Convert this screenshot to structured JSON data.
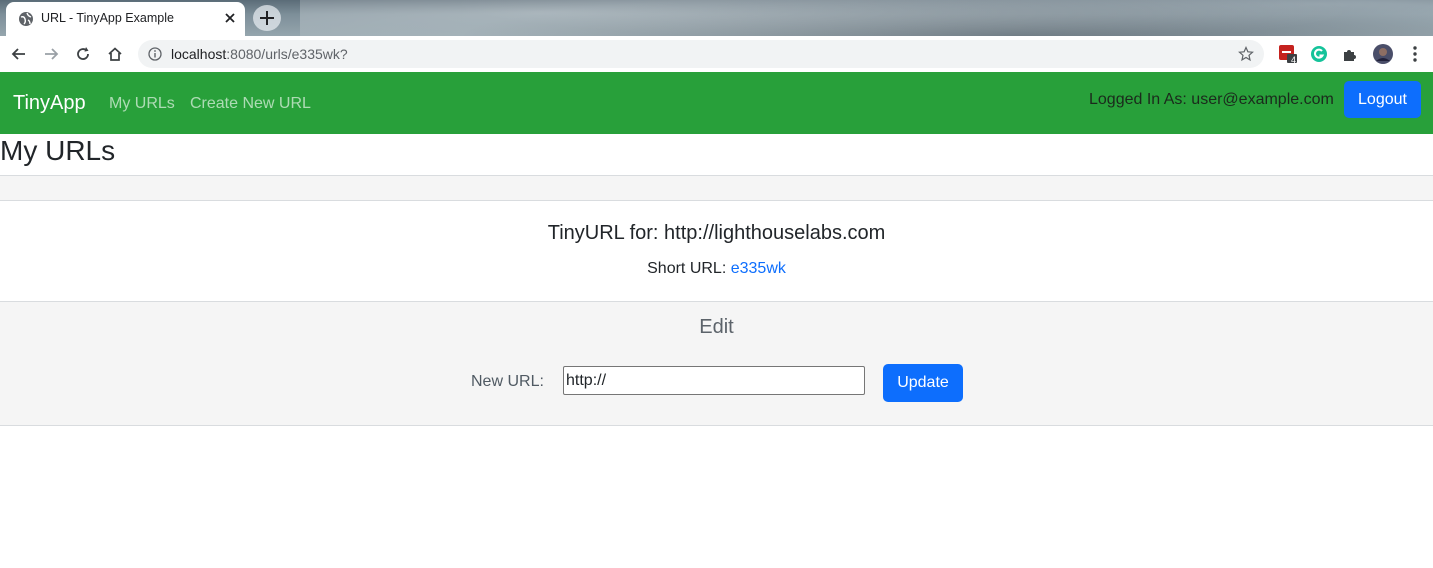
{
  "browser": {
    "tab_title": "URL - TinyApp Example",
    "address_host": "localhost",
    "address_rest": ":8080/urls/e335wk?",
    "extension_badge": "4"
  },
  "navbar": {
    "brand": "TinyApp",
    "links": [
      "My URLs",
      "Create New URL"
    ],
    "user_label": "Logged In As: user@example.com",
    "logout_label": "Logout"
  },
  "page": {
    "title": "My URLs"
  },
  "card": {
    "title": "TinyURL for: http://lighthouselabs.com",
    "short_url_label": "Short URL:",
    "short_url_value": "e335wk"
  },
  "edit": {
    "heading": "Edit",
    "new_url_label": "New URL:",
    "input_value": "http://",
    "update_label": "Update"
  },
  "colors": {
    "navbar_bg": "#28a03a",
    "primary": "#0d6efd"
  }
}
